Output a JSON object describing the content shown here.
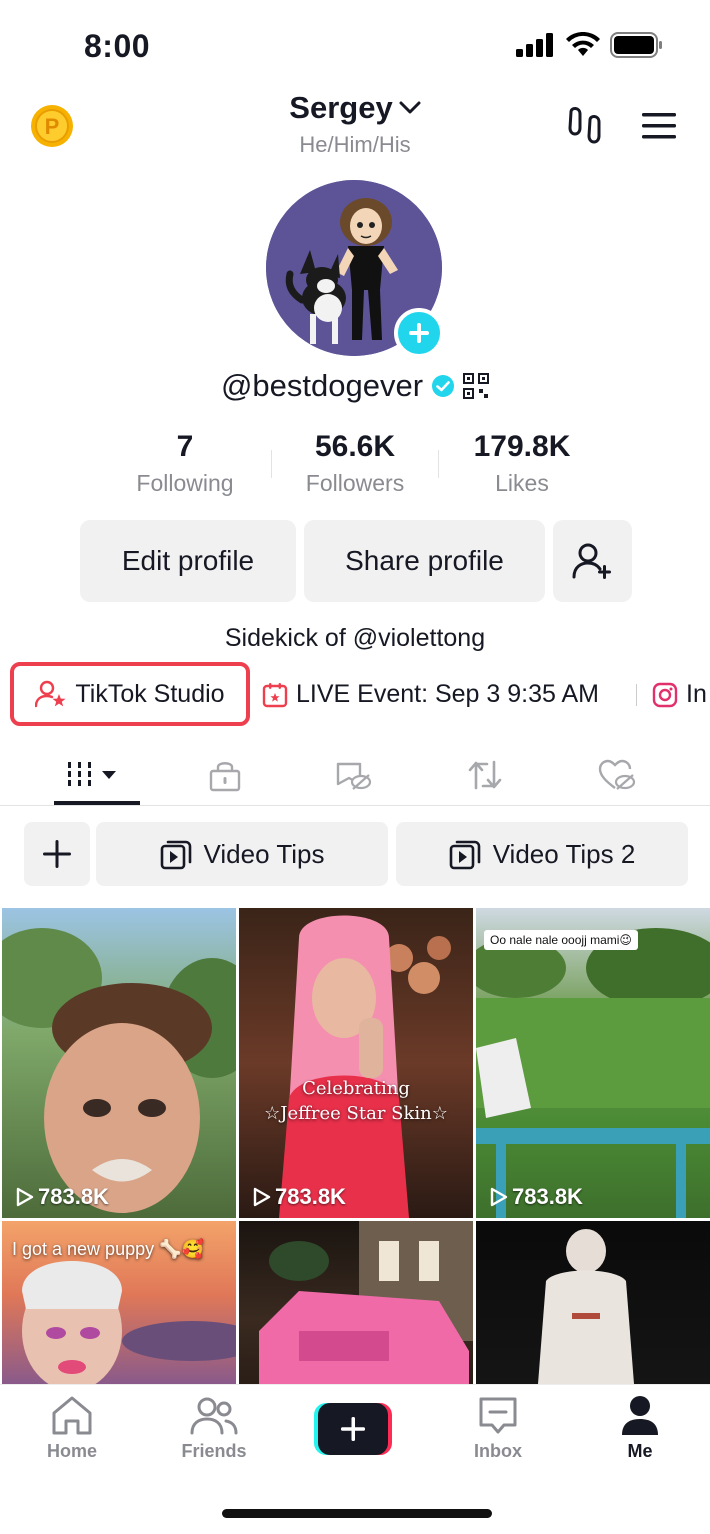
{
  "status_bar": {
    "time": "8:00"
  },
  "header": {
    "username": "Sergey",
    "pronouns": "He/Him/His"
  },
  "profile": {
    "handle": "@bestdogever",
    "stats": [
      {
        "value": "7",
        "label": "Following"
      },
      {
        "value": "56.6K",
        "label": "Followers"
      },
      {
        "value": "179.8K",
        "label": "Likes"
      }
    ],
    "edit_button": "Edit profile",
    "share_button": "Share profile",
    "bio": "Sidekick of @violettong"
  },
  "links": {
    "studio": "TikTok Studio",
    "live_event": "LIVE Event: Sep 3 9:35 AM",
    "instagram": "In"
  },
  "playlists": [
    {
      "label": "Video Tips"
    },
    {
      "label": "Video Tips 2"
    }
  ],
  "videos": [
    {
      "views": "783.8K"
    },
    {
      "views": "783.8K",
      "caption_line1": "Celebrating",
      "caption_line2": "☆Jeffree Star Skin☆"
    },
    {
      "views": "783.8K",
      "sticker": "Oo nale nale ooojj mami😉"
    },
    {
      "caption": "I got a new puppy 🦴🥰"
    },
    {},
    {}
  ],
  "bottom_nav": {
    "home": "Home",
    "friends": "Friends",
    "inbox": "Inbox",
    "me": "Me"
  },
  "colors": {
    "accent_red": "#ee3f4f",
    "cyan": "#20d5ec",
    "button_bg": "#f1f1f2",
    "muted_text": "#8a8b91"
  },
  "icons": [
    "signal-icon",
    "wifi-icon",
    "battery-icon",
    "coin-icon",
    "chevron-down-icon",
    "footprint-icon",
    "menu-icon",
    "plus-icon",
    "verified-icon",
    "qr-code-icon",
    "add-friend-icon",
    "studio-icon",
    "calendar-icon",
    "instagram-icon",
    "grid-icon",
    "lock-icon",
    "hidden-icon",
    "repost-icon",
    "liked-icon",
    "playlist-icon",
    "play-icon",
    "home-icon",
    "friends-icon",
    "inbox-icon",
    "profile-icon"
  ]
}
